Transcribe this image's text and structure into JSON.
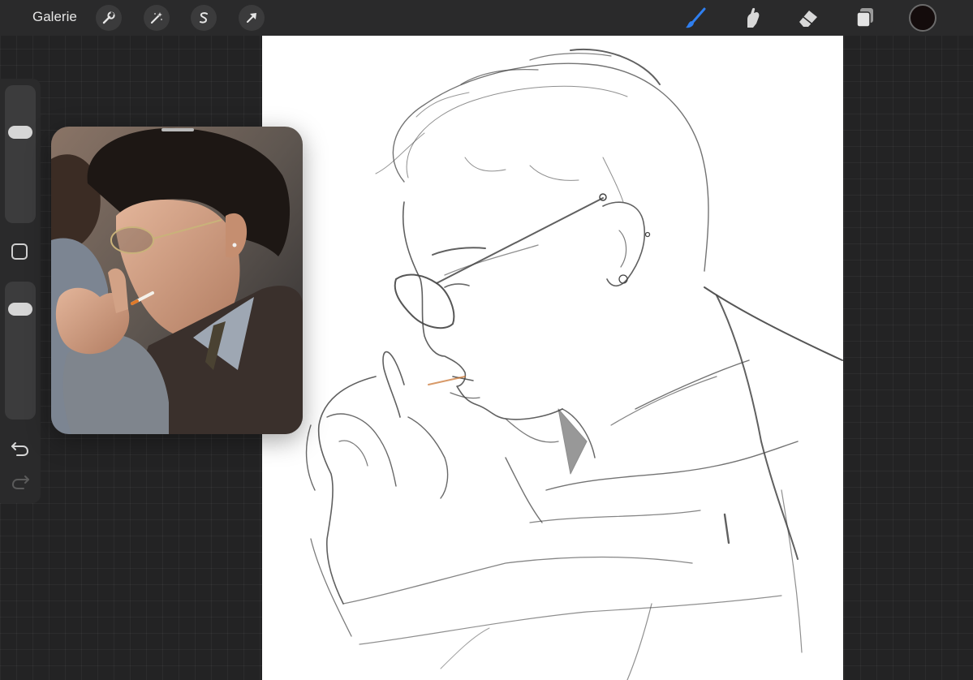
{
  "topbar": {
    "gallery_label": "Galerie",
    "left_tools": [
      {
        "name": "actions",
        "icon": "wrench-icon"
      },
      {
        "name": "adjustments",
        "icon": "magic-wand-icon"
      },
      {
        "name": "selection",
        "icon": "selection-s-icon"
      },
      {
        "name": "transform",
        "icon": "arrow-cursor-icon"
      }
    ],
    "right_tools": [
      {
        "name": "brush",
        "icon": "brush-icon",
        "active": true
      },
      {
        "name": "smudge",
        "icon": "smudge-finger-icon",
        "active": false
      },
      {
        "name": "eraser",
        "icon": "eraser-icon",
        "active": false
      },
      {
        "name": "layers",
        "icon": "layers-icon",
        "active": false
      }
    ],
    "current_color": "#140c0c",
    "active_color": "#1f6fe0"
  },
  "sidebar": {
    "brush_size": 0.75,
    "brush_opacity": 0.8,
    "icons": [
      "modify-square-icon",
      "undo-icon",
      "redo-icon"
    ]
  },
  "reference": {
    "icon": "reference-photo"
  },
  "canvas": {
    "background": "#ffffff",
    "content": "pencil-sketch"
  }
}
